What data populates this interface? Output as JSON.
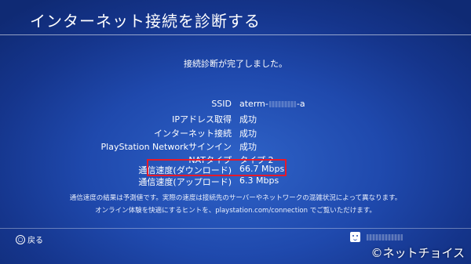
{
  "header": {
    "title": "インターネット接続を診断する"
  },
  "status_message": "接続診断が完了しました。",
  "results": [
    {
      "label": "SSID",
      "value_prefix": "aterm-",
      "value_suffix": "-a"
    },
    {
      "label": "IPアドレス取得",
      "value": "成功"
    },
    {
      "label": "インターネット接続",
      "value": "成功"
    },
    {
      "label": "PlayStation Networkサインイン",
      "value": "成功"
    },
    {
      "label": "NATタイプ",
      "value": "タイプ 2"
    },
    {
      "label": "通信速度(ダウンロード)",
      "value": "66.7 Mbps"
    },
    {
      "label": "通信速度(アップロード)",
      "value": "6.3 Mbps"
    }
  ],
  "notes": [
    "通信速度の結果は予測値です。実際の速度は接続先のサーバーやネットワークの混雑状況によって異なります。",
    "オンライン体験を快適にするヒントを、playstation.com/connection でご覧いただけます。"
  ],
  "footer": {
    "back_label": "戻る",
    "back_icon": "circle-button-icon"
  },
  "watermark": "©ネットチョイス",
  "colors": {
    "background": "#1f49ad",
    "highlight_border": "#e6192a",
    "text": "#ffffff"
  }
}
